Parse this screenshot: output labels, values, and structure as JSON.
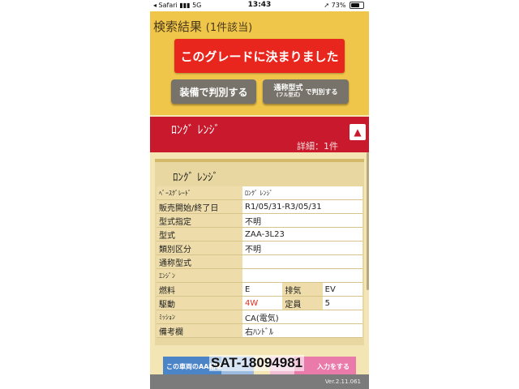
{
  "status_bar": {
    "carrier": "◂ Safari",
    "signal": "5G",
    "time": "13:43",
    "battery": "73%"
  },
  "header": {
    "title": "検索結果",
    "count": "(1件該当)",
    "decide_button": "このグレードに決まりました",
    "equip_button": "装備で判別する",
    "katashiki_button_line1": "通称型式",
    "katashiki_button_line2": "(フル型式)",
    "katashiki_button_tail": "で判別する"
  },
  "result": {
    "name": "ﾛﾝｸﾞ ﾚﾝｼﾞ",
    "detail": "詳細：1件",
    "collapse_icon": "triangle-up-icon"
  },
  "card": {
    "title": "ﾛﾝｸﾞ ﾚﾝｼﾞ",
    "rows": [
      {
        "label": "ﾍﾞｰｽｸﾞﾚｰﾄﾞ",
        "value": "ﾛﾝｸﾞ ﾚﾝｼﾞ"
      },
      {
        "label": "販売開始/終了日",
        "value": "R1/05/31-R3/05/31"
      },
      {
        "label": "型式指定",
        "value": "不明"
      },
      {
        "label": "型式",
        "value": "ZAA-3L23"
      },
      {
        "label": "類別区分",
        "value": "不明"
      },
      {
        "label": "通称型式",
        "value": ""
      },
      {
        "label": "ｴﾝｼﾞﾝ",
        "value": ""
      }
    ],
    "fuel": {
      "label": "燃料",
      "value": "E",
      "sublabel": "排気",
      "subvalue": "EV"
    },
    "drive": {
      "label": "駆動",
      "value": "4W",
      "sublabel": "定員",
      "subvalue": "5"
    },
    "mission": {
      "label": "ﾐｯｼｮﾝ",
      "value": "CA(電気)"
    },
    "remarks": {
      "label": "備考欄",
      "value": "右ﾊﾝﾄﾞﾙ"
    }
  },
  "bottom": {
    "left_button": "この車両のAA相場を見る",
    "right_button": "入力をする",
    "version": "Ver.2.11.061"
  },
  "watermark": "SAT-18094981",
  "colors": {
    "header_bg": "#f0c64a",
    "decide_red": "#e9261d",
    "band_red": "#c9192d",
    "card_bg": "#e8d7a0"
  }
}
